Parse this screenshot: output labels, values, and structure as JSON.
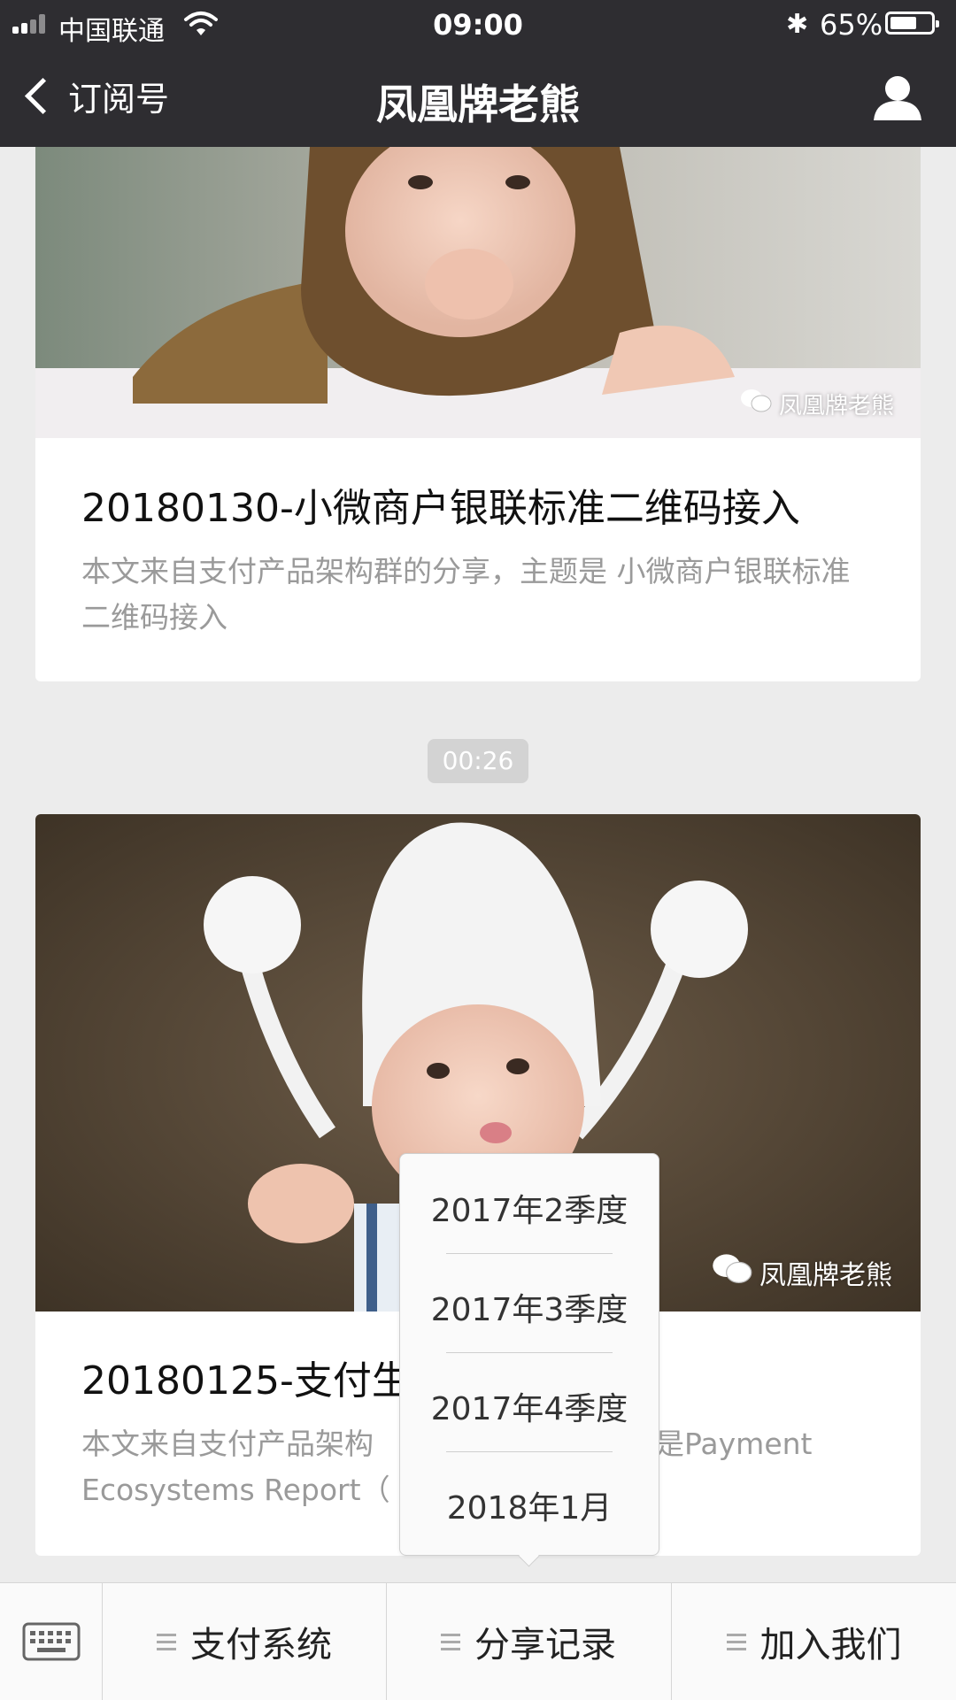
{
  "status_bar": {
    "carrier": "中国联通",
    "time": "09:00",
    "battery_percent": "65%",
    "battery_level": 0.65
  },
  "nav": {
    "back_label": "订阅号",
    "title": "凤凰牌老熊"
  },
  "articles": [
    {
      "title": "20180130-小微商户银联标准二维码接入",
      "summary": "本文来自支付产品架构群的分享，主题是 小微商户银联标准二维码接入",
      "watermark": "凤凰牌老熊"
    },
    {
      "title": "20180125-支付生",
      "summary_visible_left": "本文来自支付产品架构",
      "summary_visible_right": "是Payment",
      "summary_line2": "Ecosystems Report（",
      "watermark": "凤凰牌老熊"
    }
  ],
  "timestamp": "00:26",
  "bottom_menu": {
    "items": [
      {
        "label": "支付系统"
      },
      {
        "label": "分享记录"
      },
      {
        "label": "加入我们"
      }
    ]
  },
  "submenu": {
    "items": [
      {
        "label": "2017年2季度"
      },
      {
        "label": "2017年3季度"
      },
      {
        "label": "2017年4季度"
      },
      {
        "label": "2018年1月"
      }
    ]
  },
  "icons": {
    "back": "chevron-left-icon",
    "profile": "person-icon",
    "keyboard": "keyboard-icon",
    "menu": "hamburger-icon",
    "wechat": "wechat-icon"
  }
}
